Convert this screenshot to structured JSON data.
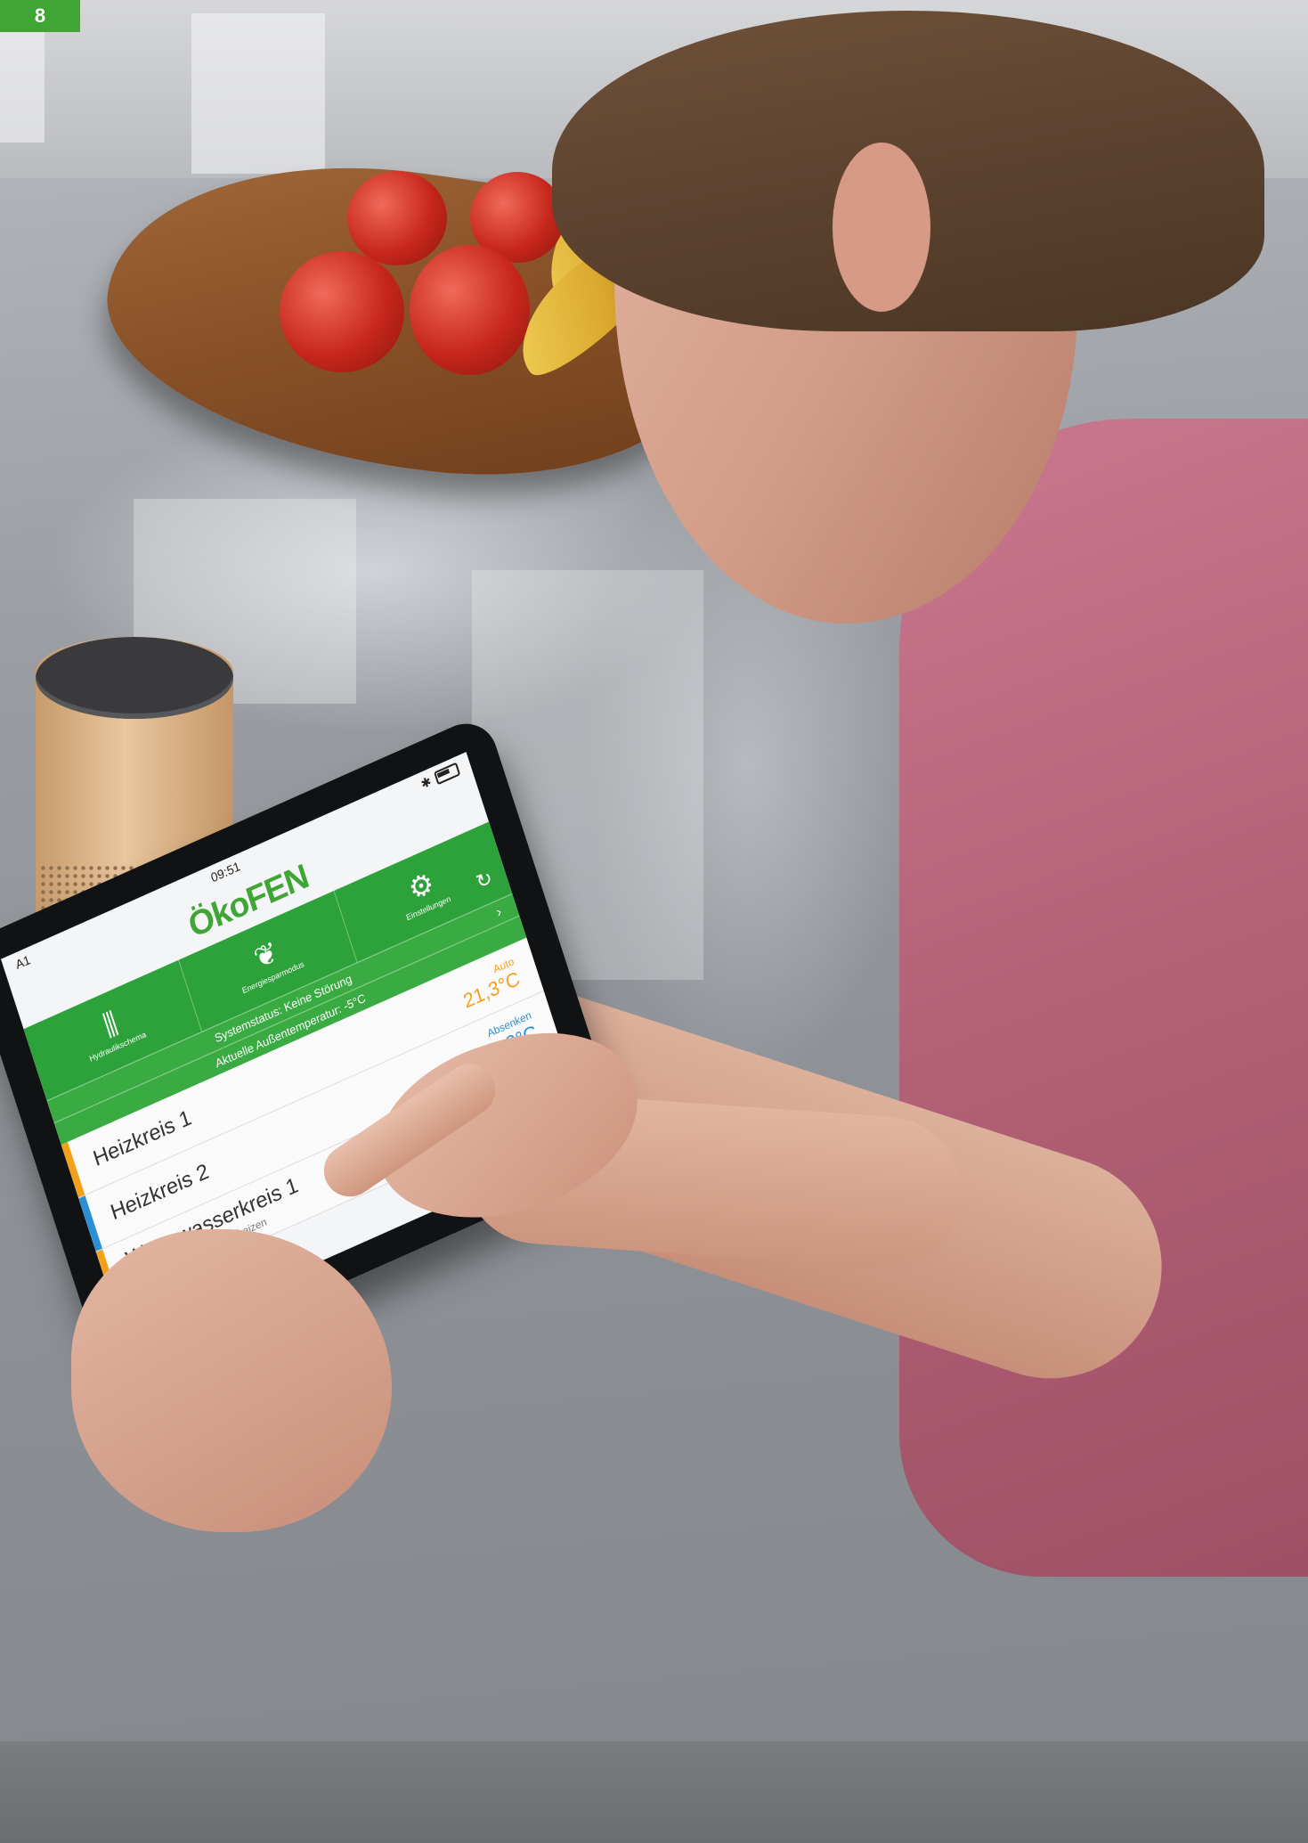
{
  "page_number": "8",
  "tablet": {
    "status_bar": {
      "carrier": "A1",
      "time": "09:51"
    },
    "logo": "ÖkoFEN",
    "nav": [
      {
        "label": "Hydraulikschema",
        "icon": "sliders-icon"
      },
      {
        "label": "Energiespar­modus",
        "icon": "leaf-icon"
      },
      {
        "label": "Einstellungen",
        "icon": "gear-icon"
      }
    ],
    "system_status": "Systemstatus: Keine Störung",
    "outside_temp": "Aktuelle Außentemperatur: -5°C",
    "rows": [
      {
        "title": "Heizkreis 1",
        "subtitle": "",
        "mode": "Auto",
        "temp": "21,3°C",
        "accent": "#f2a21a",
        "mode_color": "#f2a21a"
      },
      {
        "title": "Heizkreis 2",
        "subtitle": "",
        "mode": "Absenken",
        "temp": "19,8°C",
        "accent": "#2b8fd6",
        "mode_color": "#2b8fd6"
      },
      {
        "title": "Warmwasserkreis 1",
        "subtitle": "Warmwasser einmal aufheizen",
        "mode": "",
        "temp": "°C",
        "accent": "#f2a21a",
        "mode_color": "#f2a21a"
      }
    ]
  },
  "colors": {
    "brand_green": "#3fa535",
    "nav_green": "#2ea23a",
    "shirt": "#b26076"
  }
}
